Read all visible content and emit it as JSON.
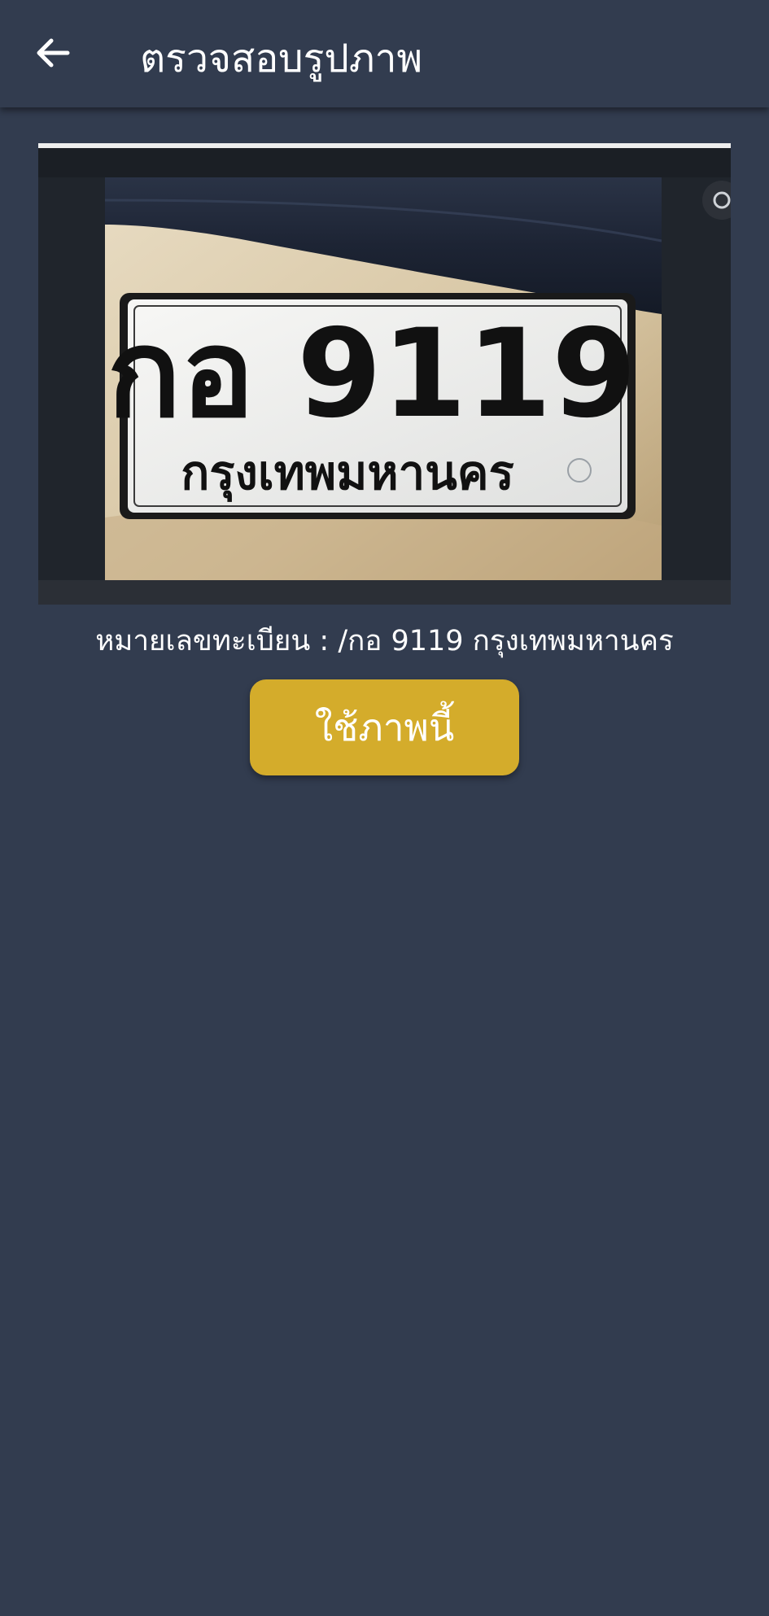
{
  "app_bar": {
    "title": "ตรวจสอบรูปภาพ",
    "back_icon": "arrow-left-icon"
  },
  "photo": {
    "plate_main": "กอ 9119",
    "plate_province": "กรุงเทพมหานคร"
  },
  "result": {
    "label_text": "หมายเลขทะเบียน : /กอ 9119 กรุงเทพมหานคร"
  },
  "actions": {
    "use_photo_label": "ใช้ภาพนี้"
  },
  "colors": {
    "background": "#323c4f",
    "button": "#d4ac2b",
    "text": "#ffffff"
  }
}
